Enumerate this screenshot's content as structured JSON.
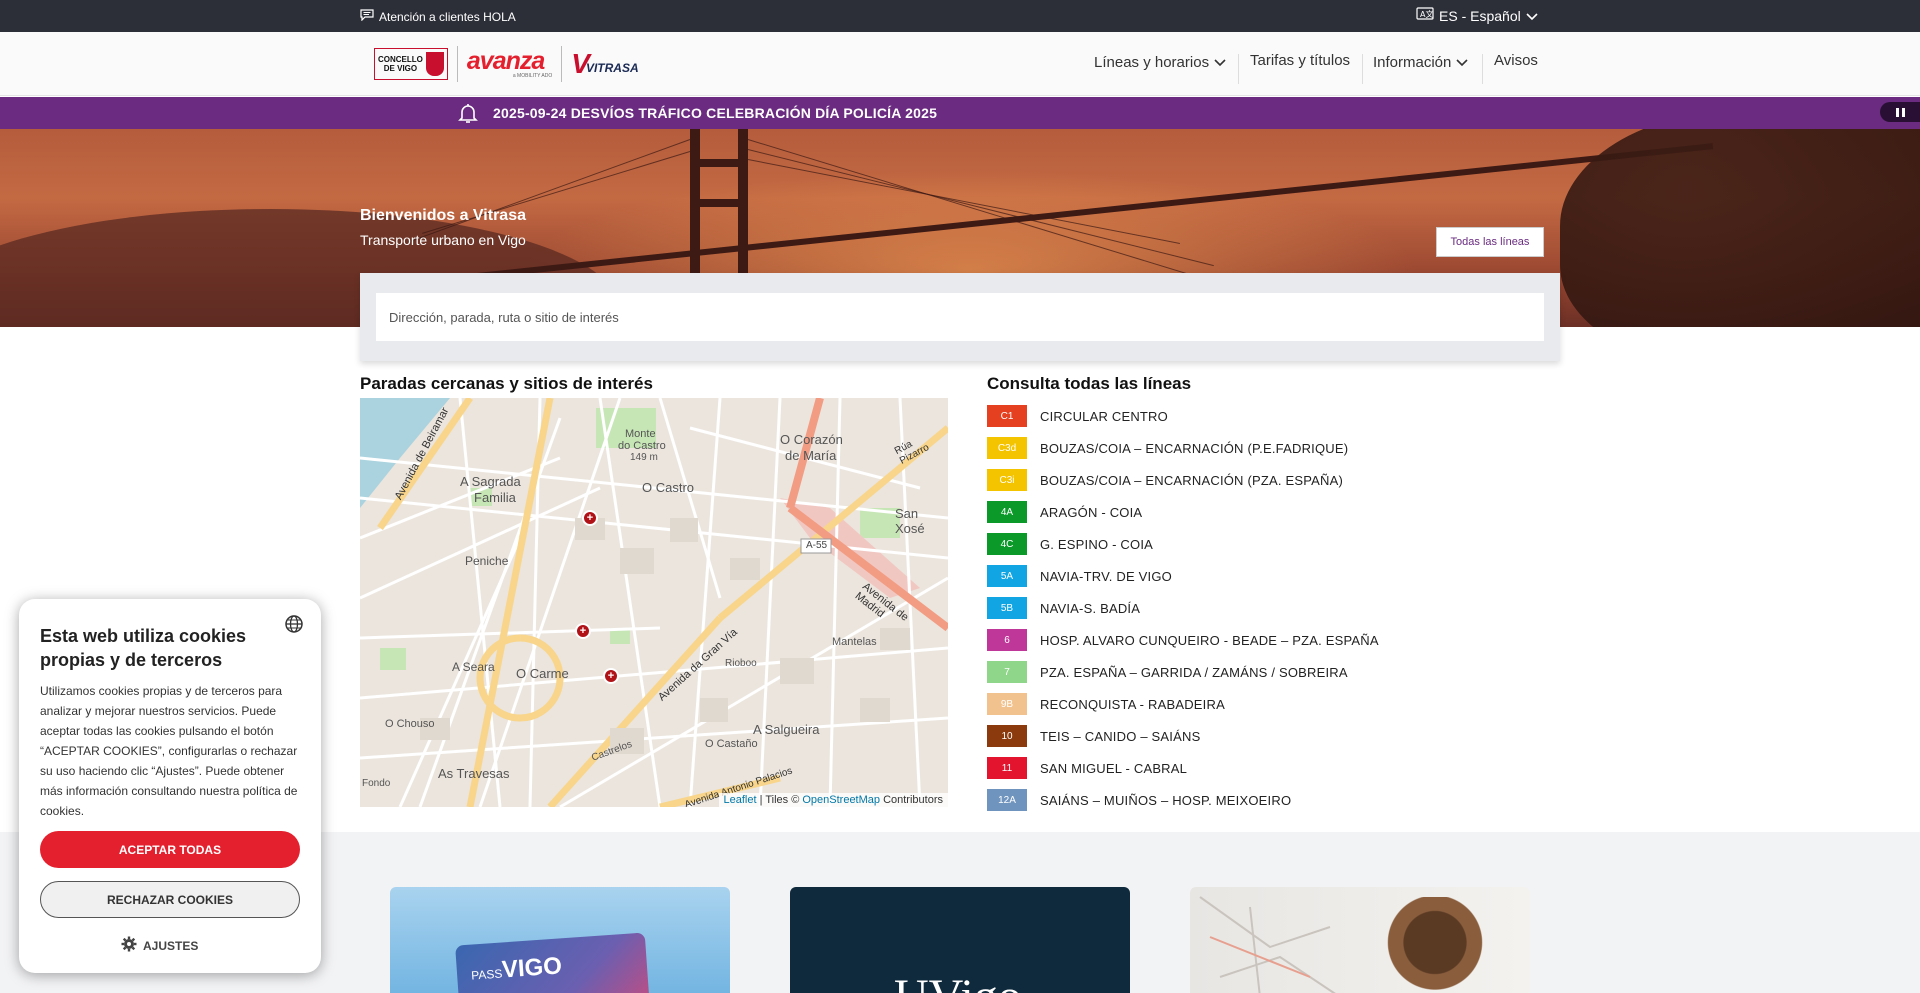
{
  "topbar": {
    "support_label": "Atención a clientes HOLA",
    "language_label": "ES - Español"
  },
  "header": {
    "logos": {
      "concello_line1": "CONCELLO",
      "concello_line2": "DE VIGO",
      "avanza": "avanza",
      "avanza_sub": "a MOBILITY ADO",
      "vitrasa": "VITRASA"
    },
    "nav": [
      {
        "label": "Líneas y horarios",
        "dropdown": true
      },
      {
        "label": "Tarifas y títulos",
        "dropdown": false
      },
      {
        "label": "Información",
        "dropdown": true
      },
      {
        "label": "Avisos",
        "dropdown": false
      }
    ]
  },
  "alert": {
    "message": "2025-09-24 DESVÍOS TRÁFICO CELEBRACIÓN DÍA POLICÍA 2025",
    "color": "#6a2b80"
  },
  "hero": {
    "welcome": "Bienvenidos a Vitrasa",
    "subtitle": "Transporte urbano en Vigo",
    "all_lines_button": "Todas las líneas"
  },
  "search": {
    "placeholder": "Dirección, parada, ruta o sitio de interés"
  },
  "nearby": {
    "title": "Paradas cercanas y sitios de interés",
    "map": {
      "labels": {
        "a_sagrada_familia_1": "A Sagrada",
        "a_sagrada_familia_2": "Familia",
        "o_castro": "O Castro",
        "monte_do_castro_1": "Monte",
        "monte_do_castro_2": "do Castro",
        "elevation": "149 m",
        "o_corazon_1": "O Corazón",
        "o_corazon_2": "de María",
        "san_xose": "San Xosé",
        "peniche": "Peniche",
        "a_seara": "A Seara",
        "o_carme": "O Carme",
        "o_chouso": "O Chouso",
        "as_travesas": "As Travesas",
        "o_castano": "O Castaño",
        "a_salgueira": "A Salgueira",
        "mantelas": "Mantelas",
        "rioboo": "Rioboo",
        "a55": "A-55",
        "avenida_madrid": "Avenida de Madrid",
        "avenida_gran_via": "Avenida da Gran Vía",
        "avenida_beiramar": "Avenida de Beiramar",
        "avenida_palacios": "Avenida Antonio Palacios",
        "rua_pizarro": "Rúa Pizarro",
        "fondo": "Fondo",
        "castrelos": "Castrelos"
      },
      "attribution": {
        "leaflet": "Leaflet",
        "tiles": " | Tiles © ",
        "osm": "OpenStreetMap",
        "contributors": " Contributors"
      }
    }
  },
  "lines_section": {
    "title": "Consulta todas las líneas",
    "lines": [
      {
        "code": "C1",
        "name": "CIRCULAR CENTRO",
        "color": "#e5401f"
      },
      {
        "code": "C3d",
        "name": "BOUZAS/COIA – ENCARNACIÓN (P.E.FADRIQUE)",
        "color": "#f5c400"
      },
      {
        "code": "C3i",
        "name": "BOUZAS/COIA – ENCARNACIÓN (PZA. ESPAÑA)",
        "color": "#f5c400"
      },
      {
        "code": "4A",
        "name": "ARAGÓN - COIA",
        "color": "#0b9a2a"
      },
      {
        "code": "4C",
        "name": "G. ESPINO - COIA",
        "color": "#0b9a2a"
      },
      {
        "code": "5A",
        "name": "NAVIA-TRV. DE VIGO",
        "color": "#12a5e3"
      },
      {
        "code": "5B",
        "name": "NAVIA-S. BADÍA",
        "color": "#12a5e3"
      },
      {
        "code": "6",
        "name": "HOSP. ALVARO CUNQUEIRO - BEADE – PZA. ESPAÑA",
        "color": "#c0379a"
      },
      {
        "code": "7",
        "name": "PZA. ESPAÑA – GARRIDA / ZAMÁNS / SOBREIRA",
        "color": "#8fd68b"
      },
      {
        "code": "9B",
        "name": "RECONQUISTA - RABADEIRA",
        "color": "#f2c28e"
      },
      {
        "code": "10",
        "name": "TEIS – CANIDO – SAIÁNS",
        "color": "#8a3a0c"
      },
      {
        "code": "11",
        "name": "SAN MIGUEL - CABRAL",
        "color": "#e3142e"
      },
      {
        "code": "12A",
        "name": "SAIÁNS – MUIÑOS – HOSP. MEIXOEIRO",
        "color": "#6f94bd"
      }
    ]
  },
  "cards": {
    "card1_pass_word": "VIGO",
    "card1_pass_prefix": "PASS",
    "card2_text": "UVigo"
  },
  "cookie": {
    "title": "Esta web utiliza cookies propias y de terceros",
    "body": "Utilizamos cookies propias y de terceros para analizar y mejorar nuestros servicios. Puede aceptar todas las cookies pulsando el botón “ACEPTAR COOKIES”, configurarlas o rechazar su uso haciendo clic “Ajustes”. Puede obtener más información consultando nuestra política de cookies.",
    "accept": "ACEPTAR TODAS",
    "reject": "RECHAZAR COOKIES",
    "settings": "AJUSTES"
  }
}
